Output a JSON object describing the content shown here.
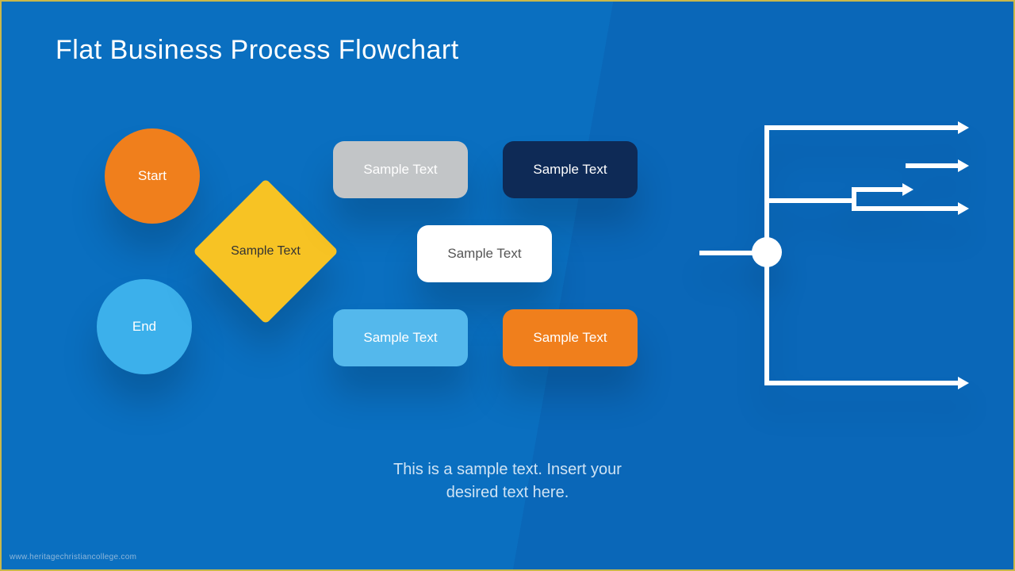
{
  "title": "Flat Business Process Flowchart",
  "caption_line1": "This is a sample text. Insert your",
  "caption_line2": "desired text here.",
  "watermark": "www.heritagechristiancollege.com",
  "shapes": {
    "start": {
      "label": "Start",
      "color": "#f07f1c",
      "text": "#ffffff"
    },
    "end": {
      "label": "End",
      "color": "#3cb0eb",
      "text": "#ffffff"
    },
    "diamond": {
      "label": "Sample Text",
      "color": "#f7c324",
      "text": "#333333"
    },
    "rect1": {
      "label": "Sample Text",
      "color": "#c2c5c7",
      "text": "#ffffff"
    },
    "rect2": {
      "label": "Sample Text",
      "color": "#0e2a56",
      "text": "#ffffff"
    },
    "rect3": {
      "label": "Sample Text",
      "color": "#ffffff",
      "text": "#555555"
    },
    "rect4": {
      "label": "Sample Text",
      "color": "#54b8ec",
      "text": "#ffffff"
    },
    "rect5": {
      "label": "Sample Text",
      "color": "#f07f1c",
      "text": "#ffffff"
    }
  },
  "branch": {
    "line_color": "#ffffff",
    "node_color": "#ffffff"
  }
}
